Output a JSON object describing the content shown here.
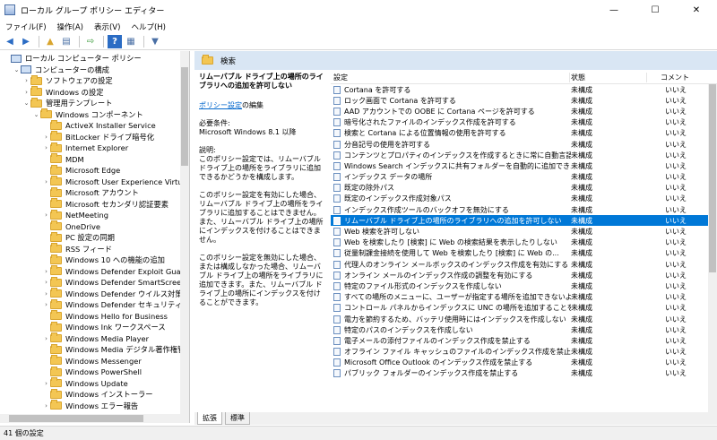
{
  "window": {
    "title": "ローカル グループ ポリシー エディター",
    "minimize": "—",
    "maximize": "☐",
    "close": "✕"
  },
  "menu": [
    "ファイル(F)",
    "操作(A)",
    "表示(V)",
    "ヘルプ(H)"
  ],
  "toolbar": {
    "back": "◀",
    "forward": "▶",
    "up": "▲",
    "show": "▤",
    "export": "⇨",
    "help": "?",
    "props": "▦",
    "filter": "▼"
  },
  "tree": {
    "items": [
      {
        "label": "ローカル コンピューター ポリシー",
        "indent": 0,
        "expander": "",
        "icon": "pc"
      },
      {
        "label": "コンピューターの構成",
        "indent": 1,
        "expander": "⌄",
        "icon": "pc"
      },
      {
        "label": "ソフトウェアの設定",
        "indent": 2,
        "expander": "›",
        "icon": "folder"
      },
      {
        "label": "Windows の設定",
        "indent": 2,
        "expander": "›",
        "icon": "folder"
      },
      {
        "label": "管理用テンプレート",
        "indent": 2,
        "expander": "⌄",
        "icon": "folder"
      },
      {
        "label": "Windows コンポーネント",
        "indent": 3,
        "expander": "⌄",
        "icon": "folder"
      },
      {
        "label": "ActiveX Installer Service",
        "indent": 4,
        "expander": "",
        "icon": "folder"
      },
      {
        "label": "BitLocker ドライブ暗号化",
        "indent": 4,
        "expander": "›",
        "icon": "folder"
      },
      {
        "label": "Internet Explorer",
        "indent": 4,
        "expander": "›",
        "icon": "folder"
      },
      {
        "label": "MDM",
        "indent": 4,
        "expander": "",
        "icon": "folder"
      },
      {
        "label": "Microsoft Edge",
        "indent": 4,
        "expander": "",
        "icon": "folder"
      },
      {
        "label": "Microsoft User Experience Virtualization",
        "indent": 4,
        "expander": "›",
        "icon": "folder"
      },
      {
        "label": "Microsoft アカウント",
        "indent": 4,
        "expander": "",
        "icon": "folder"
      },
      {
        "label": "Microsoft セカンダリ認証要素",
        "indent": 4,
        "expander": "",
        "icon": "folder"
      },
      {
        "label": "NetMeeting",
        "indent": 4,
        "expander": "›",
        "icon": "folder"
      },
      {
        "label": "OneDrive",
        "indent": 4,
        "expander": "",
        "icon": "folder"
      },
      {
        "label": "PC 設定の同期",
        "indent": 4,
        "expander": "",
        "icon": "folder"
      },
      {
        "label": "RSS フィード",
        "indent": 4,
        "expander": "",
        "icon": "folder"
      },
      {
        "label": "Windows 10 への機能の追加",
        "indent": 4,
        "expander": "",
        "icon": "folder"
      },
      {
        "label": "Windows Defender Exploit Guard",
        "indent": 4,
        "expander": "›",
        "icon": "folder"
      },
      {
        "label": "Windows Defender SmartScreen",
        "indent": 4,
        "expander": "›",
        "icon": "folder"
      },
      {
        "label": "Windows Defender ウイルス対策",
        "indent": 4,
        "expander": "›",
        "icon": "folder"
      },
      {
        "label": "Windows Defender セキュリティ センター",
        "indent": 4,
        "expander": "›",
        "icon": "folder"
      },
      {
        "label": "Windows Hello for Business",
        "indent": 4,
        "expander": "",
        "icon": "folder"
      },
      {
        "label": "Windows Ink ワークスペース",
        "indent": 4,
        "expander": "",
        "icon": "folder"
      },
      {
        "label": "Windows Media Player",
        "indent": 4,
        "expander": "›",
        "icon": "folder"
      },
      {
        "label": "Windows Media デジタル著作権管理",
        "indent": 4,
        "expander": "",
        "icon": "folder"
      },
      {
        "label": "Windows Messenger",
        "indent": 4,
        "expander": "",
        "icon": "folder"
      },
      {
        "label": "Windows PowerShell",
        "indent": 4,
        "expander": "",
        "icon": "folder"
      },
      {
        "label": "Windows Update",
        "indent": 4,
        "expander": "›",
        "icon": "folder"
      },
      {
        "label": "Windows インストーラー",
        "indent": 4,
        "expander": "",
        "icon": "folder"
      },
      {
        "label": "Windows エラー報告",
        "indent": 4,
        "expander": "›",
        "icon": "folder"
      }
    ]
  },
  "breadcrumb": "検索",
  "description": {
    "title": "リムーバブル ドライブ上の場所のライブラリへの追加を許可しない",
    "link": "ポリシー設定",
    "link_suffix": "の編集",
    "req_label": "必要条件:",
    "req_value": "Microsoft Windows 8.1 以降",
    "explain_label": "説明:",
    "p1": "このポリシー設定では、リムーバブル ドライブ上の場所をライブラリに追加できるかどうかを構成します。",
    "p2": "このポリシー設定を有効にした場合、リムーバブル ドライブ上の場所をライブラリに追加することはできません。また、リムーバブル ドライブ上の場所にインデックスを付けることはできません。",
    "p3": "このポリシー設定を無効にした場合、または構成しなかった場合、リムーバブル ドライブ上の場所をライブラリに追加できます。また、リムーバブル ドライブ上の場所にインデックスを付けることができます。"
  },
  "list": {
    "headers": {
      "setting": "設定",
      "state": "状態",
      "comment": "コメント"
    },
    "rows": [
      {
        "name": "Cortana を許可する",
        "state": "未構成",
        "comment": "いいえ"
      },
      {
        "name": "ロック画面で Cortana を許可する",
        "state": "未構成",
        "comment": "いいえ"
      },
      {
        "name": "AAD アカウントでの OOBE に Cortana ページを許可する",
        "state": "未構成",
        "comment": "いいえ"
      },
      {
        "name": "暗号化されたファイルのインデックス作成を許可する",
        "state": "未構成",
        "comment": "いいえ"
      },
      {
        "name": "検索と Cortana による位置情報の使用を許可する",
        "state": "未構成",
        "comment": "いいえ"
      },
      {
        "name": "分音記号の使用を許可する",
        "state": "未構成",
        "comment": "いいえ"
      },
      {
        "name": "コンテンツとプロパティのインデックスを作成するときに常に自動言語...",
        "state": "未構成",
        "comment": "いいえ"
      },
      {
        "name": "Windows Search インデックスに共有フォルダーを自動的に追加でき...",
        "state": "未構成",
        "comment": "いいえ"
      },
      {
        "name": "インデックス データの場所",
        "state": "未構成",
        "comment": "いいえ"
      },
      {
        "name": "既定の除外パス",
        "state": "未構成",
        "comment": "いいえ"
      },
      {
        "name": "既定のインデックス作成対象パス",
        "state": "未構成",
        "comment": "いいえ"
      },
      {
        "name": "インデックス作成ツールのバックオフを無効にする",
        "state": "未構成",
        "comment": "いいえ"
      },
      {
        "name": "リムーバブル ドライブ上の場所のライブラリへの追加を許可しない",
        "state": "未構成",
        "comment": "いいえ",
        "selected": true
      },
      {
        "name": "Web 検索を許可しない",
        "state": "未構成",
        "comment": "いいえ"
      },
      {
        "name": "Web を検索したり [検索] に Web の検索結果を表示したりしない",
        "state": "未構成",
        "comment": "いいえ"
      },
      {
        "name": "従量制課金接続を使用して Web を検索したり [検索] に Web の...",
        "state": "未構成",
        "comment": "いいえ"
      },
      {
        "name": "代理人のオンライン メールボックスのインデックス作成を有効にする",
        "state": "未構成",
        "comment": "いいえ"
      },
      {
        "name": "オンライン メールのインデックス作成の調整を有効にする",
        "state": "未構成",
        "comment": "いいえ"
      },
      {
        "name": "特定のファイル形式のインデックスを作成しない",
        "state": "未構成",
        "comment": "いいえ"
      },
      {
        "name": "すべての場所のメニューに、ユーザーが指定する場所を追加できないよ...",
        "state": "未構成",
        "comment": "いいえ"
      },
      {
        "name": "コントロール パネルからインデックスに UNC の場所を追加することを...",
        "state": "未構成",
        "comment": "いいえ"
      },
      {
        "name": "電力を節約するため、バッテリ使用時にはインデックスを作成しない",
        "state": "未構成",
        "comment": "いいえ"
      },
      {
        "name": "特定のパスのインデックスを作成しない",
        "state": "未構成",
        "comment": "いいえ"
      },
      {
        "name": "電子メールの添付ファイルのインデックス作成を禁止する",
        "state": "未構成",
        "comment": "いいえ"
      },
      {
        "name": "オフライン ファイル キャッシュのファイルのインデックス作成を禁止する",
        "state": "未構成",
        "comment": "いいえ"
      },
      {
        "name": "Microsoft Office Outlook のインデックス作成を禁止する",
        "state": "未構成",
        "comment": "いいえ"
      },
      {
        "name": "パブリック フォルダーのインデックス作成を禁止する",
        "state": "未構成",
        "comment": "いいえ"
      }
    ]
  },
  "tabs": [
    "拡張",
    "標準"
  ],
  "status": "41 個の設定"
}
